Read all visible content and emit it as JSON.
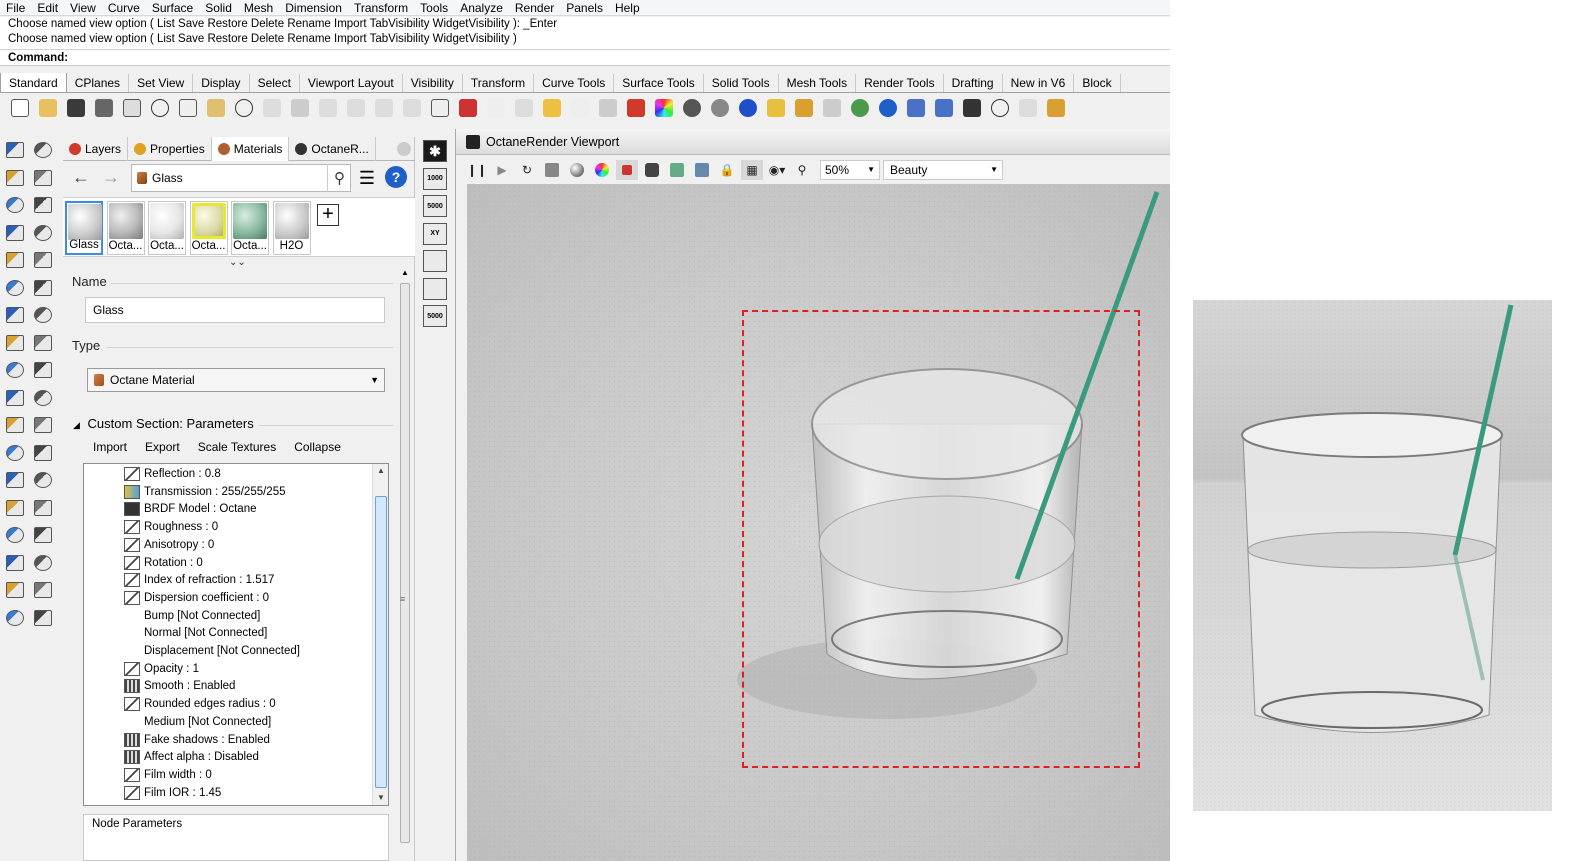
{
  "menu": [
    "File",
    "Edit",
    "View",
    "Curve",
    "Surface",
    "Solid",
    "Mesh",
    "Dimension",
    "Transform",
    "Tools",
    "Analyze",
    "Render",
    "Panels",
    "Help"
  ],
  "command": {
    "history": [
      "Choose named view option ( List  Save  Restore  Delete  Rename  Import  TabVisibility  WidgetVisibility ): _Enter",
      "Choose named view option ( List  Save  Restore  Delete  Rename  Import  TabVisibility  WidgetVisibility )"
    ],
    "prompt": "Command:"
  },
  "toolbar_tabs": [
    "Standard",
    "CPlanes",
    "Set View",
    "Display",
    "Select",
    "Viewport Layout",
    "Visibility",
    "Transform",
    "Curve Tools",
    "Surface Tools",
    "Solid Tools",
    "Mesh Tools",
    "Render Tools",
    "Drafting",
    "New in V6",
    "Block"
  ],
  "panel": {
    "tabs": [
      {
        "label": "Layers",
        "color": "#d03a2a"
      },
      {
        "label": "Properties",
        "color": "#e0a020"
      },
      {
        "label": "Materials",
        "color": "#b06030"
      },
      {
        "label": "OctaneR...",
        "color": "#333333"
      }
    ],
    "search_value": "Glass",
    "swatches": [
      {
        "label": "Glass",
        "style": "glass",
        "selected": true
      },
      {
        "label": "Octa...",
        "style": "grey"
      },
      {
        "label": "Octa...",
        "style": "white"
      },
      {
        "label": "Octa...",
        "style": "yellow"
      },
      {
        "label": "Octa...",
        "style": "green"
      },
      {
        "label": "H2O",
        "style": "glass"
      }
    ],
    "add_label": "+",
    "name_label": "Name",
    "name_value": "Glass",
    "type_label": "Type",
    "type_value": "Octane Material",
    "custom_section": "Custom Section: Parameters",
    "actions": [
      "Import",
      "Export",
      "Scale Textures",
      "Collapse"
    ],
    "params": [
      {
        "text": "Reflection : 0.8",
        "icon": "slider"
      },
      {
        "text": "Transmission : 255/255/255",
        "icon": "texture"
      },
      {
        "text": "BRDF Model : Octane",
        "icon": "dropdown"
      },
      {
        "text": "Roughness : 0",
        "icon": "slider"
      },
      {
        "text": "Anisotropy : 0",
        "icon": "slider"
      },
      {
        "text": "Rotation : 0",
        "icon": "slider"
      },
      {
        "text": "Index of refraction : 1.517",
        "icon": "slider"
      },
      {
        "text": "Dispersion coefficient : 0",
        "icon": "slider"
      },
      {
        "text": "Bump  [Not Connected]",
        "icon": "none"
      },
      {
        "text": "Normal  [Not Connected]",
        "icon": "none"
      },
      {
        "text": "Displacement  [Not Connected]",
        "icon": "none"
      },
      {
        "text": "Opacity : 1",
        "icon": "slider"
      },
      {
        "text": "Smooth : Enabled",
        "icon": "switch"
      },
      {
        "text": "Rounded edges radius : 0",
        "icon": "slider"
      },
      {
        "text": "Medium  [Not Connected]",
        "icon": "none"
      },
      {
        "text": "Fake shadows : Enabled",
        "icon": "switch"
      },
      {
        "text": "Affect alpha : Disabled",
        "icon": "switch"
      },
      {
        "text": "Film width : 0",
        "icon": "slider"
      },
      {
        "text": "Film IOR : 1.45",
        "icon": "slider"
      }
    ],
    "node_params": "Node Parameters"
  },
  "vtools": [
    "1000",
    "5000",
    "XY",
    "",
    "",
    "5000"
  ],
  "viewport": {
    "title": "OctaneRender Viewport",
    "zoom": "50%",
    "pass": "Beauty"
  }
}
